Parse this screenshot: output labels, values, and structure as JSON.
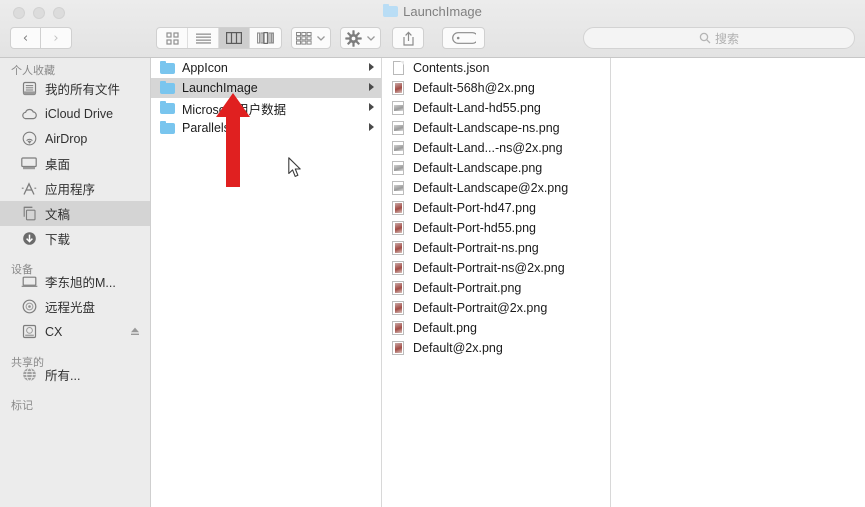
{
  "window": {
    "title": "LaunchImage",
    "traffic_lights": [
      {
        "name": "close",
        "color": "#dcdcdc"
      },
      {
        "name": "minimize",
        "color": "#dcdcdc"
      },
      {
        "name": "zoom",
        "color": "#dcdcdc"
      }
    ]
  },
  "toolbar": {
    "back_label": "‹",
    "forward_label": "›",
    "view_modes": [
      {
        "name": "icon-view",
        "active": false
      },
      {
        "name": "list-view",
        "active": false
      },
      {
        "name": "column-view",
        "active": true
      },
      {
        "name": "coverflow-view",
        "active": false
      }
    ],
    "arrange_label": "arrange-icon",
    "action_label": "gear-icon",
    "share_label": "share-icon",
    "tag_label": "tag-icon"
  },
  "search": {
    "placeholder": "搜索",
    "value": "",
    "icon": "search-icon"
  },
  "sidebar": {
    "sections": [
      {
        "title": "个人收藏",
        "items": [
          {
            "label": "我的所有文件",
            "icon": "all-files-icon",
            "selected": false
          },
          {
            "label": "iCloud Drive",
            "icon": "icloud-icon",
            "selected": false
          },
          {
            "label": "AirDrop",
            "icon": "airdrop-icon",
            "selected": false
          },
          {
            "label": "桌面",
            "icon": "desktop-icon",
            "selected": false
          },
          {
            "label": "应用程序",
            "icon": "applications-icon",
            "selected": false
          },
          {
            "label": "文稿",
            "icon": "documents-icon",
            "selected": true
          },
          {
            "label": "下载",
            "icon": "downloads-icon",
            "selected": false
          }
        ]
      },
      {
        "title": "设备",
        "items": [
          {
            "label": "李东旭的M...",
            "icon": "laptop-icon",
            "selected": false
          },
          {
            "label": "远程光盘",
            "icon": "disc-icon",
            "selected": false
          },
          {
            "label": "CX",
            "icon": "drive-icon",
            "selected": false,
            "eject": true
          }
        ]
      },
      {
        "title": "共享的",
        "items": [
          {
            "label": "所有...",
            "icon": "network-globe-icon",
            "selected": false
          }
        ]
      },
      {
        "title": "标记",
        "items": []
      }
    ]
  },
  "columns": [
    {
      "name": "column-1",
      "items": [
        {
          "label": "AppIcon",
          "icon": "folder-icon",
          "selected": false,
          "has_chevron": true
        },
        {
          "label": "LaunchImage",
          "icon": "folder-icon",
          "selected": true,
          "has_chevron": true
        },
        {
          "label": "Microsoft 用户数据",
          "icon": "folder-icon",
          "selected": false,
          "has_chevron": true
        },
        {
          "label": "Parallels",
          "icon": "folder-icon",
          "selected": false,
          "has_chevron": true
        }
      ]
    },
    {
      "name": "column-2",
      "items": [
        {
          "label": "Contents.json",
          "icon": "json-document-icon",
          "selected": false,
          "has_chevron": false
        },
        {
          "label": "Default-568h@2x.png",
          "icon": "png-portrait-icon",
          "selected": false,
          "has_chevron": false
        },
        {
          "label": "Default-Land-hd55.png",
          "icon": "png-landscape-icon",
          "selected": false,
          "has_chevron": false
        },
        {
          "label": "Default-Landscape-ns.png",
          "icon": "png-landscape-icon",
          "selected": false,
          "has_chevron": false
        },
        {
          "label": "Default-Land...-ns@2x.png",
          "icon": "png-landscape-icon",
          "selected": false,
          "has_chevron": false
        },
        {
          "label": "Default-Landscape.png",
          "icon": "png-landscape-icon",
          "selected": false,
          "has_chevron": false
        },
        {
          "label": "Default-Landscape@2x.png",
          "icon": "png-landscape-icon",
          "selected": false,
          "has_chevron": false
        },
        {
          "label": "Default-Port-hd47.png",
          "icon": "png-portrait-icon",
          "selected": false,
          "has_chevron": false
        },
        {
          "label": "Default-Port-hd55.png",
          "icon": "png-portrait-icon",
          "selected": false,
          "has_chevron": false
        },
        {
          "label": "Default-Portrait-ns.png",
          "icon": "png-portrait-icon",
          "selected": false,
          "has_chevron": false
        },
        {
          "label": "Default-Portrait-ns@2x.png",
          "icon": "png-portrait-icon",
          "selected": false,
          "has_chevron": false
        },
        {
          "label": "Default-Portrait.png",
          "icon": "png-portrait-icon",
          "selected": false,
          "has_chevron": false
        },
        {
          "label": "Default-Portrait@2x.png",
          "icon": "png-portrait-icon",
          "selected": false,
          "has_chevron": false
        },
        {
          "label": "Default.png",
          "icon": "png-portrait-icon",
          "selected": false,
          "has_chevron": false
        },
        {
          "label": "Default@2x.png",
          "icon": "png-portrait-icon",
          "selected": false,
          "has_chevron": false
        }
      ]
    },
    {
      "name": "column-3",
      "items": []
    }
  ],
  "annotation": {
    "arrow_color": "#e02020",
    "points_at": "LaunchImage"
  },
  "colors": {
    "folder_blue": "#79c5ee",
    "selection_gray": "#d6d6d6",
    "sidebar_bg": "#ececec",
    "toolbar_bg": "#e9e9e9"
  }
}
